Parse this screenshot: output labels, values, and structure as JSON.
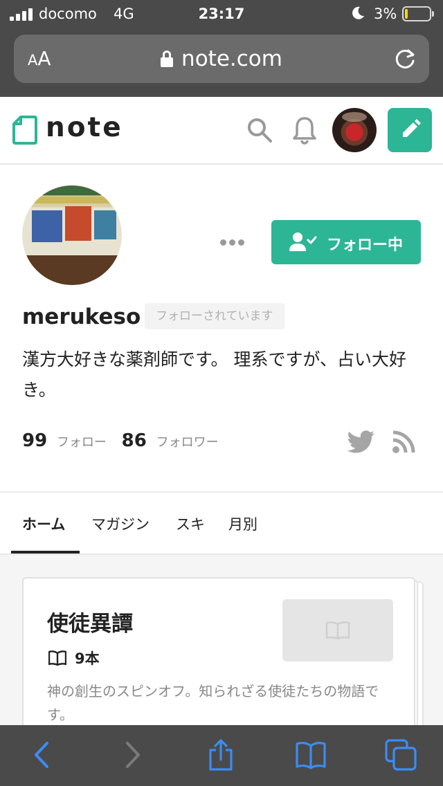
{
  "status_bar": {
    "carrier": "docomo",
    "network": "4G",
    "time": "23:17",
    "battery_percent": "3%",
    "battery_color": "#ffd60a"
  },
  "browser": {
    "text_size_label_small": "A",
    "text_size_label_large": "A",
    "url": "note.com",
    "lock_icon": "lock-icon",
    "reload_icon": "reload-icon"
  },
  "header": {
    "logo_text": "note",
    "accent_color": "#2cb696",
    "search_icon": "search-icon",
    "notification_icon": "bell-icon",
    "post_icon": "pencil-icon"
  },
  "profile": {
    "follow_button_label": "フォロー中",
    "username": "merukeso",
    "follows_you_badge": "フォローされています",
    "bio": "漢方大好きな薬剤師です。 理系ですが、占い大好き。",
    "following_count": "99",
    "following_label": "フォロー",
    "followers_count": "86",
    "followers_label": "フォロワー",
    "social_icons": [
      "twitter-icon",
      "rss-icon"
    ]
  },
  "tabs": [
    {
      "label": "ホーム",
      "active": true
    },
    {
      "label": "マガジン",
      "active": false
    },
    {
      "label": "スキ",
      "active": false
    },
    {
      "label": "月別",
      "active": false
    }
  ],
  "magazine_card": {
    "title": "使徒異譚",
    "count": "9本",
    "description": "神の創生のスピンオフ。知られざる使徒たちの物語です。"
  },
  "toolbar": {
    "icons": [
      "back-icon",
      "forward-icon",
      "share-icon",
      "bookmarks-icon",
      "tabs-icon"
    ],
    "active_color": "#3b8cf5",
    "disabled_color": "#7a7a7a"
  }
}
